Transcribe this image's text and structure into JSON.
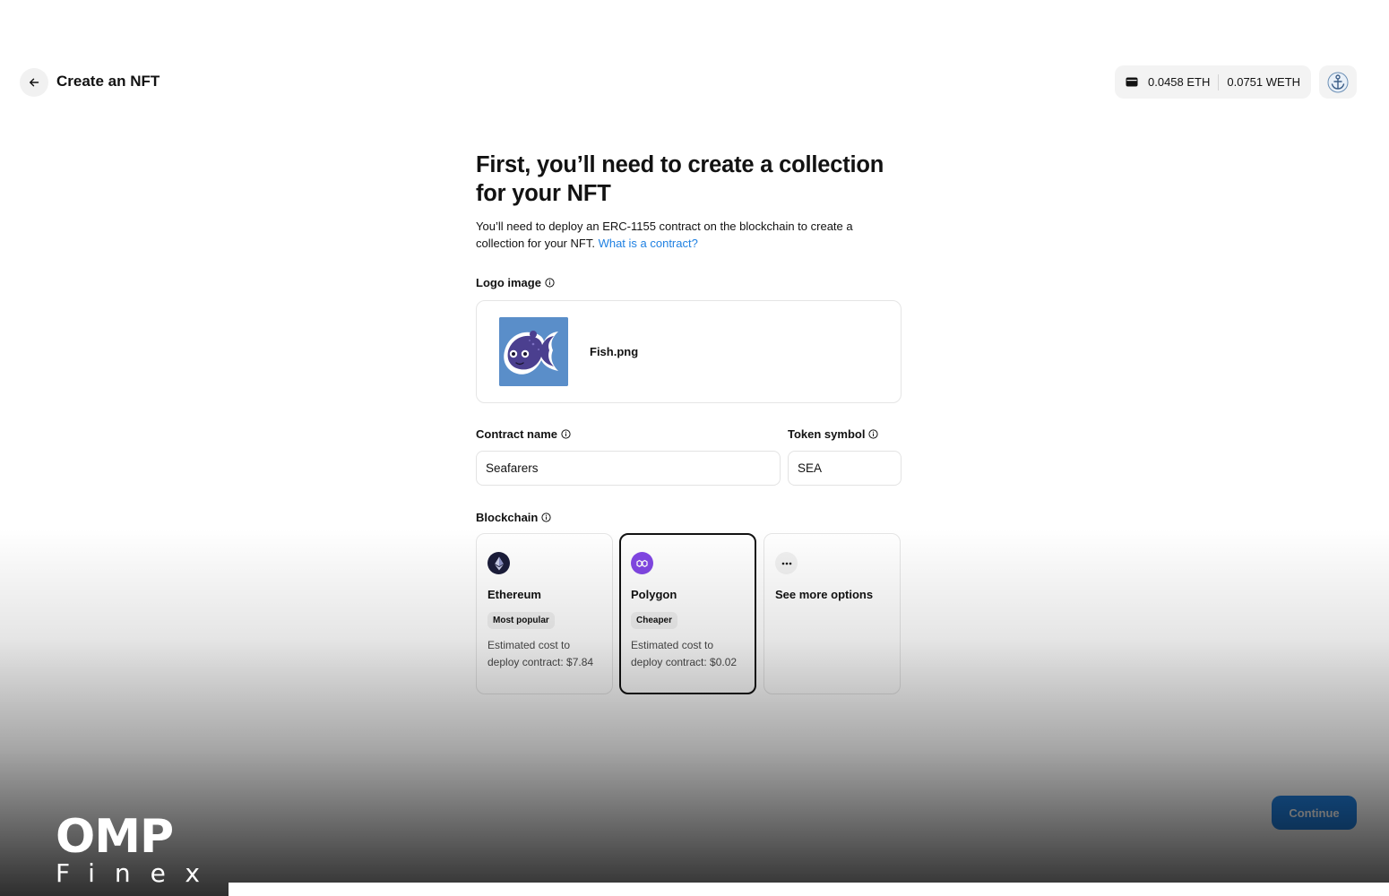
{
  "header": {
    "title": "Create an NFT",
    "back_icon": "arrow-left-icon",
    "wallet": {
      "icon": "wallet-icon",
      "eth": "0.0458 ETH",
      "weth": "0.0751 WETH"
    },
    "avatar_icon": "anchor-icon"
  },
  "main": {
    "heading": "First, you’ll need to create a collection for your NFT",
    "description": "You’ll need to deploy an ERC-1155 contract on the blockchain to create a collection for your NFT.",
    "help_link": "What is a contract?",
    "logo": {
      "label": "Logo image",
      "file_name": "Fish.png"
    },
    "contract_name": {
      "label": "Contract name",
      "value": "Seafarers"
    },
    "token_symbol": {
      "label": "Token symbol",
      "value": "SEA"
    },
    "blockchain": {
      "label": "Blockchain",
      "options": [
        {
          "name": "Ethereum",
          "badge": "Most popular",
          "cost": "Estimated cost to deploy contract: $7.84",
          "selected": false
        },
        {
          "name": "Polygon",
          "badge": "Cheaper",
          "cost": "Estimated cost to deploy contract: $0.02",
          "selected": true
        },
        {
          "name": "See more options",
          "badge": "",
          "cost": "",
          "selected": false
        }
      ]
    }
  },
  "footer": {
    "continue_label": "Continue"
  },
  "watermark": {
    "line1": "OMP",
    "line2": "Finex"
  },
  "colors": {
    "accent": "#2081e2",
    "polygon": "#8247e5",
    "ethereum": "#1b1d3a"
  }
}
